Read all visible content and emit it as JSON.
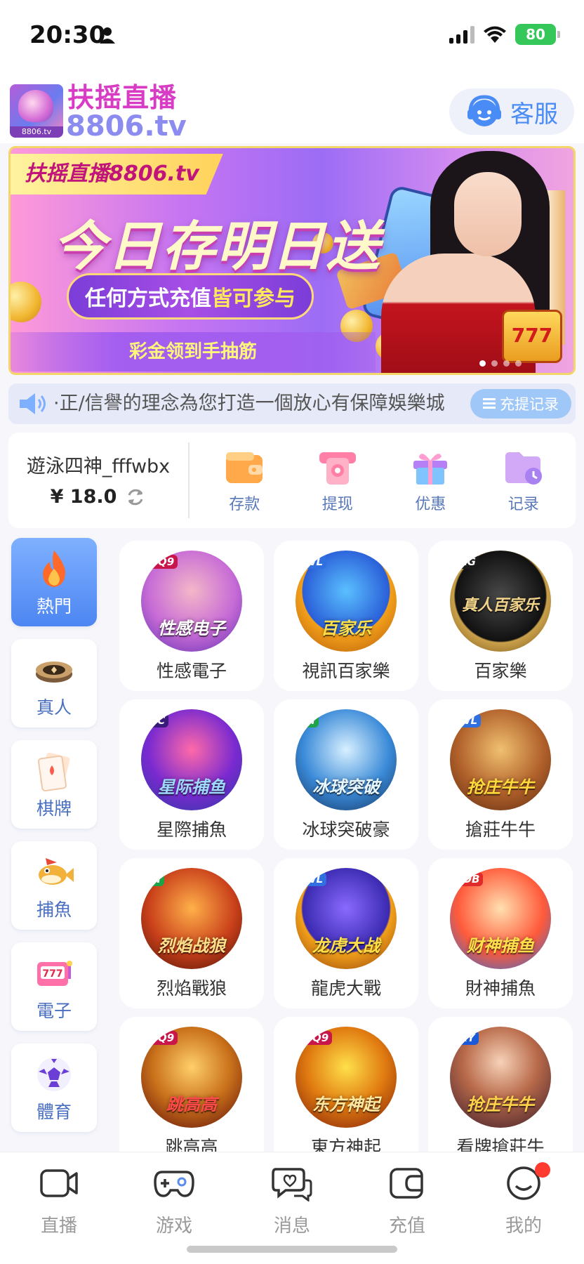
{
  "status_bar": {
    "time": "20:30",
    "battery": "80"
  },
  "header": {
    "logo_title": "扶摇直播",
    "logo_sub": "8806.tv",
    "logo_tag": "8806.tv",
    "service_label": "客服"
  },
  "banner": {
    "tag": "扶摇直播8806.tv",
    "headline": "今日存明日送",
    "pill_text": "任何方式充值",
    "pill_highlight": "皆可参与",
    "strip": "彩金领到手抽筋",
    "slot": "777"
  },
  "marquee": {
    "text": "·正/信譽的理念為您打造一個放心有保障娛樂城",
    "button": "充提记录"
  },
  "wallet": {
    "username": "遊泳四神_fffwbx",
    "balance": "¥ 18.0",
    "actions": [
      {
        "label": "存款",
        "icon": "wallet-icon"
      },
      {
        "label": "提现",
        "icon": "withdraw-icon"
      },
      {
        "label": "优惠",
        "icon": "gift-icon"
      },
      {
        "label": "记录",
        "icon": "folder-clock-icon"
      }
    ]
  },
  "categories": [
    {
      "label": "熱門",
      "icon": "fire-icon",
      "active": true
    },
    {
      "label": "真人",
      "icon": "poker-chip-icon"
    },
    {
      "label": "棋牌",
      "icon": "playing-card-icon"
    },
    {
      "label": "捕魚",
      "icon": "fish-icon"
    },
    {
      "label": "電子",
      "icon": "slot-machine-icon"
    },
    {
      "label": "體育",
      "icon": "soccer-ball-icon"
    }
  ],
  "games": [
    {
      "name": "性感電子",
      "art_text": "性感电子",
      "badge": "CQ9"
    },
    {
      "name": "視訊百家樂",
      "art_text": "百家乐",
      "badge": "WL"
    },
    {
      "name": "百家樂",
      "art_text": "真人百家乐",
      "badge": "AG"
    },
    {
      "name": "星際捕魚",
      "art_text": "星际捕鱼",
      "badge": "FC"
    },
    {
      "name": "冰球突破豪",
      "art_text": "冰球突破",
      "badge": "M"
    },
    {
      "name": "搶莊牛牛",
      "art_text": "抢庄牛牛",
      "badge": "WL"
    },
    {
      "name": "烈焰戰狼",
      "art_text": "烈焰战狼",
      "badge": "M"
    },
    {
      "name": "龍虎大戰",
      "art_text": "龙虎大战",
      "badge": "WL"
    },
    {
      "name": "財神捕魚",
      "art_text": "财神捕鱼",
      "badge": "JDB"
    },
    {
      "name": "跳高高",
      "art_text": "跳高高",
      "badge": "CQ9"
    },
    {
      "name": "東方神起",
      "art_text": "东方神起",
      "badge": "CQ9"
    },
    {
      "name": "看牌搶莊牛",
      "art_text": "抢庄牛牛",
      "badge": "KY"
    }
  ],
  "bottom_nav": [
    {
      "label": "直播",
      "icon": "camera-icon"
    },
    {
      "label": "游戏",
      "icon": "gamepad-icon"
    },
    {
      "label": "消息",
      "icon": "chat-icon"
    },
    {
      "label": "充值",
      "icon": "wallet-icon"
    },
    {
      "label": "我的",
      "icon": "smile-icon",
      "badge_dot": true
    }
  ],
  "colors": {
    "accent": "#4d86f2",
    "logo_pink": "#d83cc4",
    "logo_purple": "#8c8cf0",
    "service_blue": "#4a8cf5",
    "nav_badge": "#ff3b30"
  }
}
